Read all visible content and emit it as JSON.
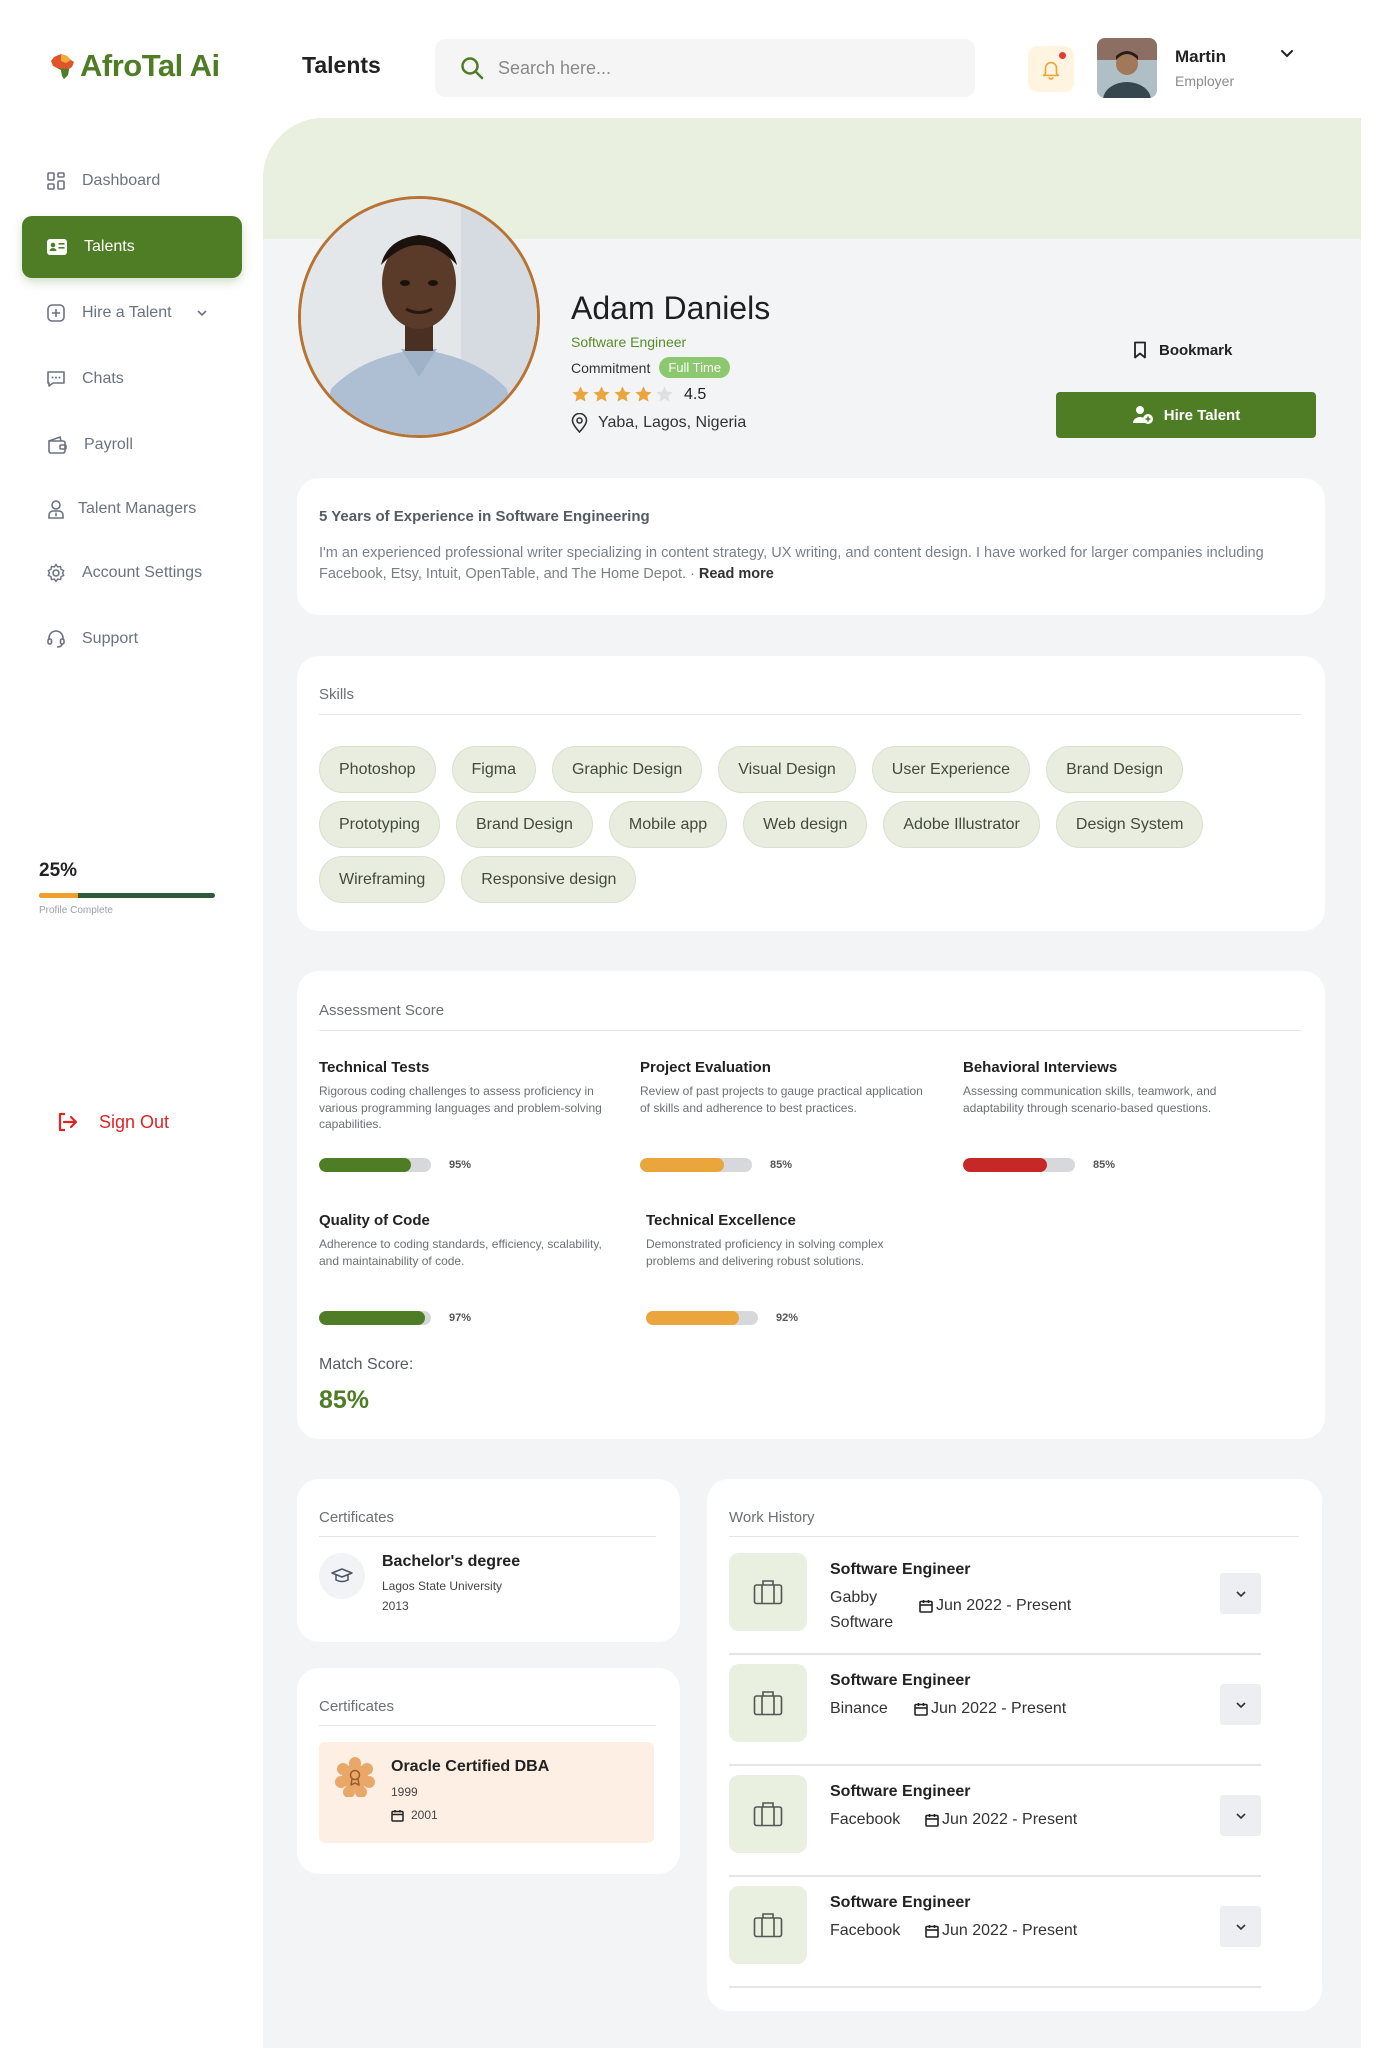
{
  "app": {
    "logo_text": "AfroTal Ai",
    "page_heading": "Talents"
  },
  "search": {
    "placeholder": "Search here..."
  },
  "user": {
    "name": "Martin",
    "role": "Employer"
  },
  "sidebar": {
    "items": [
      {
        "label": "Dashboard",
        "icon": "dashboard-icon"
      },
      {
        "label": "Talents",
        "icon": "id-card-icon",
        "active": true
      },
      {
        "label": "Hire a Talent",
        "icon": "plus-square-icon"
      },
      {
        "label": "Chats",
        "icon": "chat-icon"
      },
      {
        "label": "Payroll",
        "icon": "wallet-icon"
      },
      {
        "label": "Talent Managers",
        "icon": "user-tie-icon"
      },
      {
        "label": "Account Settings",
        "icon": "gear-icon"
      },
      {
        "label": "Support",
        "icon": "headset-icon"
      }
    ],
    "profile_progress": {
      "percent_label": "25%",
      "value": 0.22,
      "caption": "Profile Complete"
    },
    "sign_out": "Sign Out"
  },
  "profile": {
    "name": "Adam Daniels",
    "title": "Software Engineer",
    "commitment_label": "Commitment",
    "commitment_value": "Full Time",
    "rating": "4.5",
    "rating_value": 4.5,
    "location": "Yaba, Lagos, Nigeria",
    "bookmark_label": "Bookmark",
    "hire_label": "Hire Talent"
  },
  "about": {
    "heading": "5 Years of Experience in Software Engineering",
    "text": "I'm an experienced professional writer specializing in content strategy, UX writing, and content design. I have worked for larger companies including Facebook, Etsy, Intuit, OpenTable, and The Home Depot. · ",
    "read_more": "Read more"
  },
  "skills": {
    "title": "Skills",
    "items": [
      "Photoshop",
      "Figma",
      "Graphic Design",
      "Visual Design",
      "User Experience",
      "Brand Design",
      "Prototyping",
      "Brand Design",
      "Mobile app",
      "Web design",
      "Adobe Illustrator",
      "Design System",
      "Wireframing",
      "Responsive design"
    ]
  },
  "assessment": {
    "title": "Assessment Score",
    "items": [
      {
        "title": "Technical Tests",
        "desc": "Rigorous coding challenges to assess proficiency in various programming languages and problem-solving capabilities.",
        "pct": "95%",
        "fill": 0.82,
        "color": "#4e7d26"
      },
      {
        "title": "Project Evaluation",
        "desc": "Review of past projects to gauge practical application of skills and adherence to best practices.",
        "pct": "85%",
        "fill": 0.75,
        "color": "#eaa63c"
      },
      {
        "title": "Behavioral Interviews",
        "desc": "Assessing communication skills, teamwork, and adaptability through scenario-based questions.",
        "pct": "85%",
        "fill": 0.75,
        "color": "#c62828"
      },
      {
        "title": "Quality of Code",
        "desc": "Adherence to coding standards, efficiency, scalability, and maintainability of code.",
        "pct": "97%",
        "fill": 0.95,
        "color": "#4e7d26"
      },
      {
        "title": "Technical Excellence",
        "desc": "Demonstrated proficiency in solving complex problems and delivering robust solutions.",
        "pct": "92%",
        "fill": 0.83,
        "color": "#eaa63c"
      }
    ],
    "match_label": "Match Score:",
    "match_value": "85%"
  },
  "certificates": [
    {
      "title": "Certificates",
      "name": "Bachelor's degree",
      "institution": "Lagos State University",
      "year": "2013",
      "icon": "graduation-cap-icon"
    },
    {
      "title": "Certificates",
      "name": "Oracle Certified DBA",
      "year": "1999",
      "date": "2001",
      "icon": "award-badge-icon"
    }
  ],
  "work_history": {
    "title": "Work History",
    "jobs": [
      {
        "title": "Software Engineer",
        "company_line1": "Gabby",
        "company_line2": "Software",
        "date": "Jun 2022 - Present"
      },
      {
        "title": "Software Engineer",
        "company_line1": "Binance",
        "company_line2": "",
        "date": "Jun 2022 - Present"
      },
      {
        "title": "Software Engineer",
        "company_line1": "Facebook",
        "company_line2": "",
        "date": "Jun 2022 - Present"
      },
      {
        "title": "Software Engineer",
        "company_line1": "Facebook",
        "company_line2": "",
        "date": "Jun 2022 - Present"
      }
    ]
  },
  "colors": {
    "brand_green": "#4e7d26",
    "banner": "#e9f0df",
    "panel": "#f3f4f6",
    "accent_orange": "#eaa63c",
    "danger_red": "#e02424"
  }
}
